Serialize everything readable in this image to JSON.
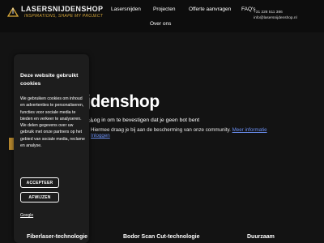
{
  "header": {
    "logo_name": "LASERSNIJDENSHOP",
    "logo_tagline": "INSPIRATIONS, SHAPE MY PROJECT",
    "nav": [
      "Lasersnijden",
      "Projecten",
      "Offerte aanvragen",
      "FAQ's",
      "Over ons"
    ],
    "contact_phone": "+31 228 511 386",
    "contact_email": "info@lasersnijdenshop.nl"
  },
  "hero": {
    "title": "Lasersnijdenshop",
    "behind_text": "jden",
    "subtitle": "Log in om te bevestigen dat je geen bot bent",
    "description": "Hiermee draag je bij aan de bescherming van onze community.",
    "more_info_link": "Meer informatie",
    "login_link": "Inloggen"
  },
  "cookie_banner": {
    "title": "Deze website gebruikt cookies",
    "text": "We gebruiken cookies om inhoud en advertenties te personaliseren, functies voor sociale media te bieden en verkeer te analyseren. We delen gegevens over uw gebruik met onze partners op het gebied van sociale media, reclame en analyse.",
    "accept_label": "ACCEPTEER",
    "decline_label": "AFWIJZEN",
    "google_link": "Google"
  },
  "features": [
    "Fiberlaser-technologie",
    "Bodor Scan Cut-technologie",
    "Duurzaam"
  ],
  "colors": {
    "accent_gold": "#d8a83a",
    "background": "#131313",
    "link_blue": "#6a8ef0"
  }
}
